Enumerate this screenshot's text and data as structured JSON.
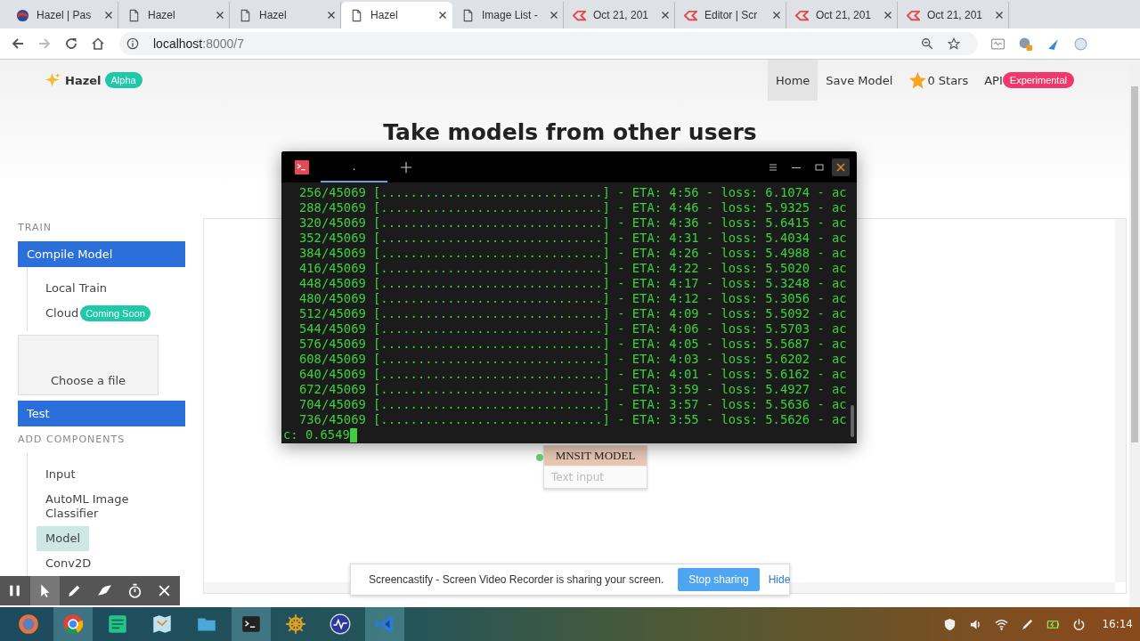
{
  "browser": {
    "tabs": [
      {
        "title": "Hazel | Pas",
        "kind": "globe",
        "selected": false
      },
      {
        "title": "Hazel",
        "kind": "page",
        "selected": false
      },
      {
        "title": "Hazel",
        "kind": "page",
        "selected": false
      },
      {
        "title": "Hazel",
        "kind": "page",
        "selected": true
      },
      {
        "title": "Image List -",
        "kind": "page",
        "selected": false
      },
      {
        "title": "Oct 21, 201",
        "kind": "record",
        "selected": false
      },
      {
        "title": "Editor | Scr",
        "kind": "record",
        "selected": false
      },
      {
        "title": "Oct 21, 201",
        "kind": "record",
        "selected": false
      },
      {
        "title": "Oct 21, 201",
        "kind": "record",
        "selected": false
      }
    ],
    "address": {
      "host": "localhost",
      "path": ":8000/7"
    }
  },
  "page": {
    "brand": {
      "name": "Hazel",
      "badge": "Alpha"
    },
    "nav": [
      {
        "label": "Home",
        "selected": true
      },
      {
        "label": "Save Model",
        "selected": false
      },
      {
        "label": "0 Stars",
        "kind": "stars",
        "selected": false
      },
      {
        "label": "API",
        "badge": "Experimental",
        "selected": false
      }
    ],
    "heading": "Take models from other users",
    "sidebar": [
      {
        "kind": "heading",
        "label": "TRAIN"
      },
      {
        "kind": "button",
        "label": "Compile Model"
      },
      {
        "kind": "group",
        "items": [
          {
            "label": "Local Train",
            "selected": false
          },
          {
            "label": "Cloud",
            "badge": "Coming Soon",
            "selected": false
          }
        ]
      },
      {
        "kind": "file",
        "label": "Choose a file"
      },
      {
        "kind": "button",
        "label": "Test"
      },
      {
        "kind": "heading",
        "label": "ADD COMPONENTS"
      },
      {
        "kind": "group",
        "items": [
          {
            "label": "Input",
            "selected": false
          },
          {
            "label": "AutoML Image Classifier",
            "selected": false
          },
          {
            "label": "Model",
            "selected": true
          },
          {
            "label": "Conv2D",
            "selected": false
          }
        ]
      }
    ],
    "canvas": {
      "node": {
        "title": "MNSIT MODEL",
        "placeholder": "Text input"
      }
    }
  },
  "terminal": {
    "tabs": [
      {
        "label": ".",
        "selected": true
      }
    ],
    "lines": [
      "256/45069 [..............................] - ETA: 4:56 - loss: 6.1074 - ac",
      "288/45069 [..............................] - ETA: 4:46 - loss: 5.9325 - ac",
      "320/45069 [..............................] - ETA: 4:36 - loss: 5.6415 - ac",
      "352/45069 [..............................] - ETA: 4:31 - loss: 5.4034 - ac",
      "384/45069 [..............................] - ETA: 4:26 - loss: 5.4988 - ac",
      "416/45069 [..............................] - ETA: 4:22 - loss: 5.5020 - ac",
      "448/45069 [..............................] - ETA: 4:17 - loss: 5.3248 - ac",
      "480/45069 [..............................] - ETA: 4:12 - loss: 5.3056 - ac",
      "512/45069 [..............................] - ETA: 4:09 - loss: 5.5092 - ac",
      "544/45069 [..............................] - ETA: 4:06 - loss: 5.5703 - ac",
      "576/45069 [..............................] - ETA: 4:05 - loss: 5.5687 - ac",
      "608/45069 [..............................] - ETA: 4:03 - loss: 5.6202 - ac",
      "640/45069 [..............................] - ETA: 4:01 - loss: 5.6162 - ac",
      "672/45069 [..............................] - ETA: 3:59 - loss: 5.4927 - ac",
      "704/45069 [..............................] - ETA: 3:57 - loss: 5.5636 - ac",
      "736/45069 [..............................] - ETA: 3:55 - loss: 5.5626 - ac"
    ],
    "prompt": "c: 0.6549"
  },
  "share_bar": {
    "message": "Screencastify - Screen Video Recorder is sharing your screen.",
    "stop_button": "Stop sharing",
    "hide_link": "Hide"
  },
  "recorder_toolbar": [
    {
      "kind": "pause",
      "selected": false
    },
    {
      "kind": "pointer",
      "selected": true
    },
    {
      "kind": "pen",
      "selected": false
    },
    {
      "kind": "eraser",
      "selected": false
    },
    {
      "kind": "timer",
      "selected": false
    },
    {
      "kind": "close",
      "selected": false
    }
  ],
  "taskbar": {
    "apps": [
      {
        "kind": "launcher",
        "active": false
      },
      {
        "kind": "browser",
        "active": true
      },
      {
        "kind": "editor",
        "active": false
      },
      {
        "kind": "map",
        "active": false
      },
      {
        "kind": "folder",
        "active": false
      },
      {
        "kind": "terminal",
        "active": true
      },
      {
        "kind": "wheel",
        "active": false
      },
      {
        "kind": "monitor",
        "active": false
      },
      {
        "kind": "code",
        "active": true
      }
    ],
    "time": "16:14"
  }
}
